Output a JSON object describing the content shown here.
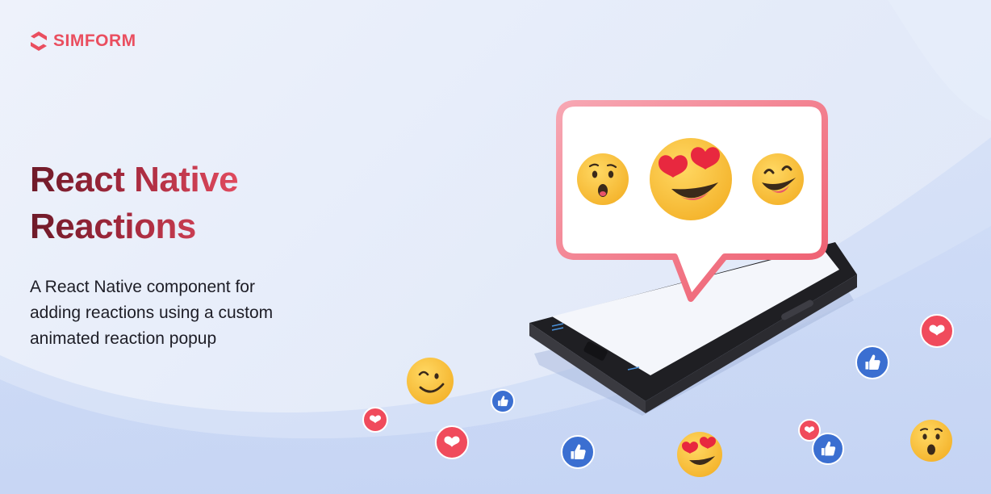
{
  "brand": {
    "name": "SIMFORM",
    "logo_icon": "simform-logo-icon",
    "color": "#ea4e5f"
  },
  "hero": {
    "title_lines": [
      "React Native",
      "Reactions"
    ],
    "description_lines": [
      "A React Native component for",
      "adding reactions using a custom",
      "animated reaction popup"
    ]
  },
  "illustration": {
    "popup_reactions": [
      "surprised-emoji-icon",
      "heart-eyes-emoji-icon",
      "laughing-emoji-icon"
    ],
    "floating_reactions": [
      "smile-emoji-icon",
      "like-icon",
      "heart-icon",
      "heart-eyes-emoji-icon",
      "surprised-emoji-icon"
    ],
    "colors": {
      "heart": "#f04b5c",
      "like": "#3b6fd1",
      "emoji": "#f9c43c",
      "phone": "#2f2f33"
    }
  }
}
